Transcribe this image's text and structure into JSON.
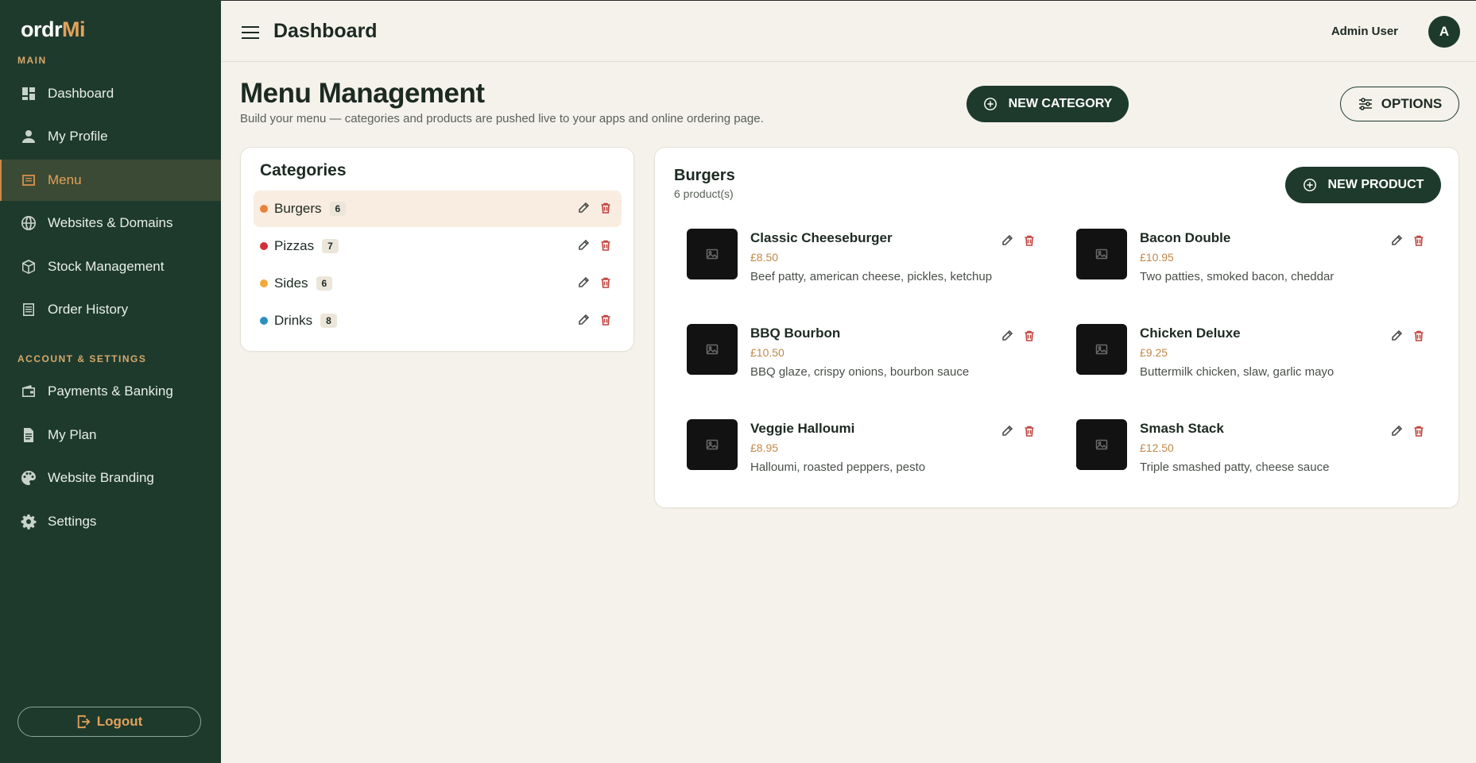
{
  "brand": {
    "logo_main": "ordr",
    "logo_accent": "Mi"
  },
  "sidebar": {
    "section_main": "MAIN",
    "section_account": "ACCOUNT & SETTINGS",
    "items": [
      {
        "label": "Dashboard",
        "icon": "dashboard-icon"
      },
      {
        "label": "My Profile",
        "icon": "user-icon"
      },
      {
        "label": "Menu",
        "icon": "menu-list-icon"
      },
      {
        "label": "Websites & Domains",
        "icon": "globe-icon"
      },
      {
        "label": "Stock Management",
        "icon": "box-icon"
      },
      {
        "label": "Order History",
        "icon": "receipt-icon"
      },
      {
        "label": "Payments & Banking",
        "icon": "wallet-icon"
      },
      {
        "label": "My Plan",
        "icon": "document-icon"
      },
      {
        "label": "Website Branding",
        "icon": "palette-icon"
      },
      {
        "label": "Settings",
        "icon": "gear-icon"
      }
    ],
    "logout_label": "Logout"
  },
  "topbar": {
    "title": "Dashboard",
    "user_name": "Admin User",
    "avatar_initial": "A"
  },
  "main": {
    "title": "Menu Management",
    "subtitle": "Build your menu — categories and products are pushed live to your apps and online ordering page.",
    "new_category_label": "NEW CATEGORY",
    "options_label": "OPTIONS"
  },
  "categories": {
    "title": "Categories",
    "items": [
      {
        "name": "Burgers",
        "count": "6",
        "color": "#e8833a"
      },
      {
        "name": "Pizzas",
        "count": "7",
        "color": "#d32f3a"
      },
      {
        "name": "Sides",
        "count": "6",
        "color": "#f2a93b"
      },
      {
        "name": "Drinks",
        "count": "8",
        "color": "#2a8fbf"
      }
    ]
  },
  "products": {
    "title": "Burgers",
    "count_label": "6 product(s)",
    "new_product_label": "NEW PRODUCT",
    "items": [
      {
        "name": "Classic Cheeseburger",
        "price": "£8.50",
        "desc": "Beef patty, american cheese, pickles, ketchup"
      },
      {
        "name": "Bacon Double",
        "price": "£10.95",
        "desc": "Two patties, smoked bacon, cheddar"
      },
      {
        "name": "BBQ Bourbon",
        "price": "£10.50",
        "desc": "BBQ glaze, crispy onions, bourbon sauce"
      },
      {
        "name": "Chicken Deluxe",
        "price": "£9.25",
        "desc": "Buttermilk chicken, slaw, garlic mayo"
      },
      {
        "name": "Veggie Halloumi",
        "price": "£8.95",
        "desc": "Halloumi, roasted peppers, pesto"
      },
      {
        "name": "Smash Stack",
        "price": "£12.50",
        "desc": "Triple smashed patty, cheese sauce"
      }
    ]
  }
}
